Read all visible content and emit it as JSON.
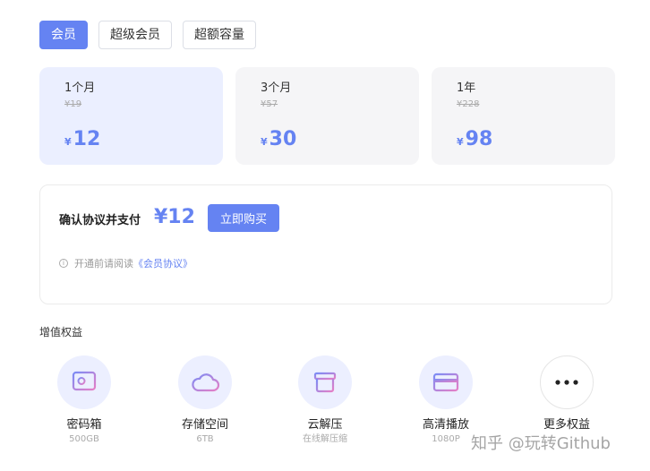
{
  "tabs": [
    {
      "label": "会员",
      "active": true
    },
    {
      "label": "超级会员",
      "active": false
    },
    {
      "label": "超额容量",
      "active": false
    }
  ],
  "plans": [
    {
      "name": "1个月",
      "original": "¥19",
      "currency": "¥",
      "price": "12",
      "selected": true
    },
    {
      "name": "3个月",
      "original": "¥57",
      "currency": "¥",
      "price": "30",
      "selected": false
    },
    {
      "name": "1年",
      "original": "¥228",
      "currency": "¥",
      "price": "98",
      "selected": false
    }
  ],
  "confirm": {
    "title": "确认协议并支付",
    "price": "¥12",
    "buy_label": "立即购买",
    "notice_prefix": "开通前请阅读",
    "agreement_link": "《会员协议》"
  },
  "benefits_title": "增值权益",
  "benefits": [
    {
      "name": "密码箱",
      "sub": "500GB",
      "icon": "safe-icon"
    },
    {
      "name": "存储空间",
      "sub": "6TB",
      "icon": "cloud-icon"
    },
    {
      "name": "云解压",
      "sub": "在线解压缩",
      "icon": "archive-box-icon"
    },
    {
      "name": "高清播放",
      "sub": "1080P",
      "icon": "card-player-icon"
    },
    {
      "name": "更多权益",
      "sub": "",
      "icon": "more-dots-icon"
    }
  ],
  "watermark": "知乎 @玩转Github",
  "colors": {
    "accent": "#6583f2",
    "selected_bg": "#ebefff",
    "card_bg": "#f5f5f7"
  }
}
